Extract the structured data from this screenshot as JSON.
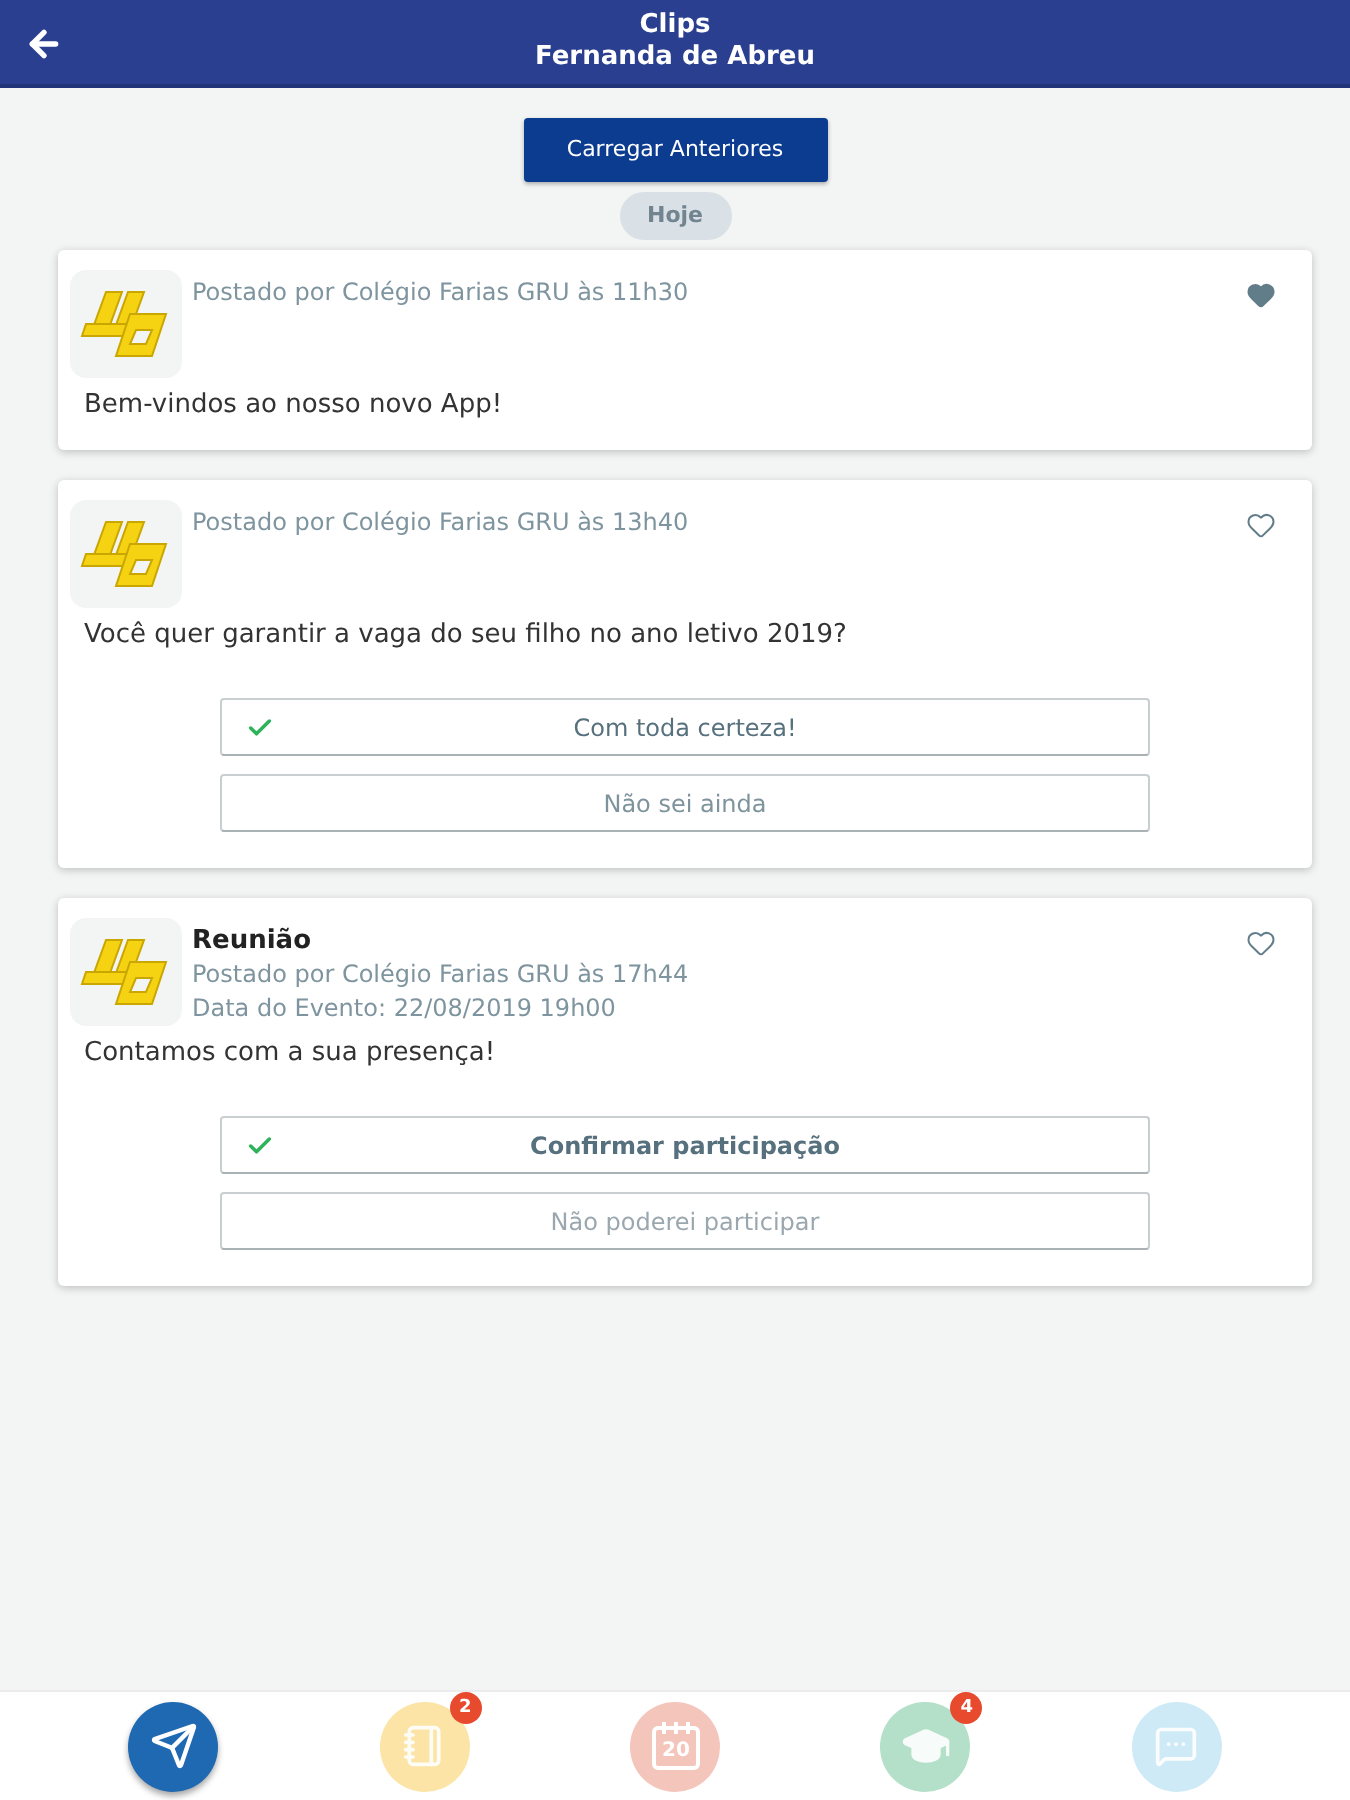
{
  "header": {
    "title": "Clips",
    "subtitle": "Fernanda de Abreu"
  },
  "load_button": "Carregar Anteriores",
  "day_chip": "Hoje",
  "posts": [
    {
      "kind": "message",
      "posted": "Postado por Colégio Farias GRU às 11h30",
      "liked": true,
      "body": "Bem-vindos ao nosso novo App!"
    },
    {
      "kind": "poll",
      "posted": "Postado por Colégio Farias GRU às 13h40",
      "liked": false,
      "body": "Você quer garantir a vaga do seu filho no ano letivo 2019?",
      "options": [
        {
          "label": "Com toda certeza!",
          "selected": true
        },
        {
          "label": "Não sei ainda",
          "selected": false
        }
      ]
    },
    {
      "kind": "event",
      "title": "Reunião",
      "posted": "Postado por Colégio Farias GRU às 17h44",
      "event_date": "Data do Evento: 22/08/2019 19h00",
      "liked": false,
      "body": "Contamos com a sua presença!",
      "options": [
        {
          "label": "Confirmar participação",
          "selected": true
        },
        {
          "label": "Não poderei participar",
          "selected": false
        }
      ]
    }
  ],
  "bottom_nav": [
    {
      "kind": "send",
      "selected": true,
      "color": "#1f68b2"
    },
    {
      "kind": "notebook",
      "selected": false,
      "color": "#fbe4a6",
      "badge": "2"
    },
    {
      "kind": "calendar",
      "selected": false,
      "color": "#f4c5bb",
      "label": "20"
    },
    {
      "kind": "graduation",
      "selected": false,
      "color": "#b4dfc9",
      "badge": "4"
    },
    {
      "kind": "chat",
      "selected": false,
      "color": "#cdeaf6"
    }
  ]
}
